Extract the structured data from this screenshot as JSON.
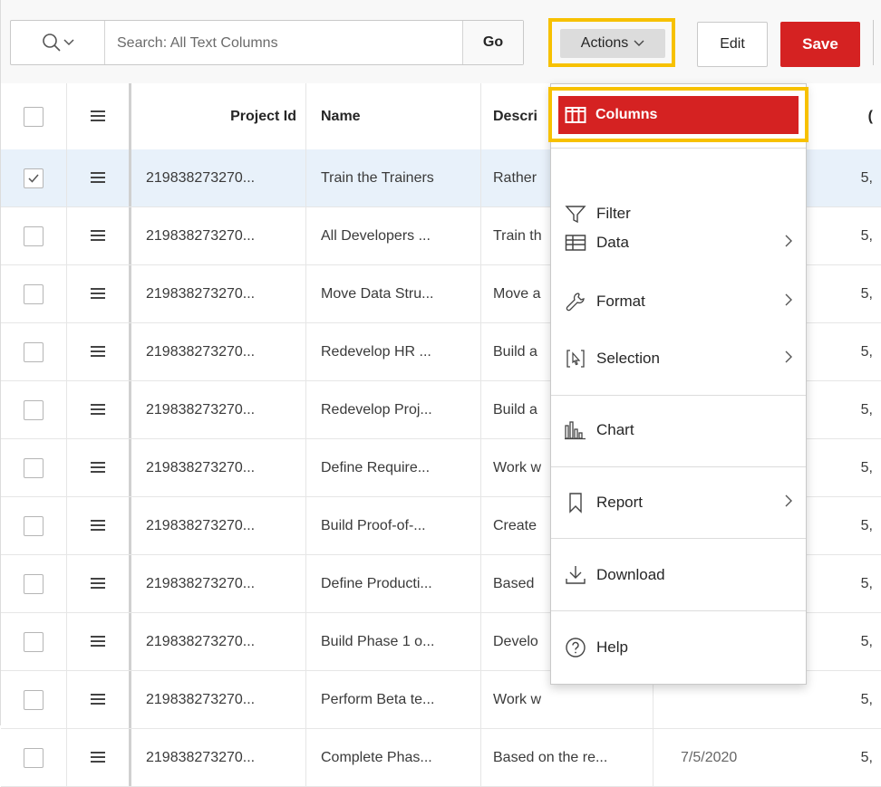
{
  "toolbar": {
    "search_placeholder": "Search: All Text Columns",
    "go_label": "Go",
    "actions_label": "Actions",
    "edit_label": "Edit",
    "save_label": "Save"
  },
  "grid": {
    "headers": {
      "project_id": "Project Id",
      "name": "Name",
      "description": "Descri",
      "date": "("
    },
    "rows": [
      {
        "project_id": "219838273270...",
        "name": "Train the Trainers",
        "description": "Rather",
        "date": "5,",
        "selected": true
      },
      {
        "project_id": "219838273270...",
        "name": "All Developers ...",
        "description": "Train th",
        "date": "5,"
      },
      {
        "project_id": "219838273270...",
        "name": "Move Data Stru...",
        "description": "Move a",
        "date": "5,"
      },
      {
        "project_id": "219838273270...",
        "name": "Redevelop HR ...",
        "description": "Build a",
        "date": "5,"
      },
      {
        "project_id": "219838273270...",
        "name": "Redevelop Proj...",
        "description": "Build a",
        "date": "5,"
      },
      {
        "project_id": "219838273270...",
        "name": "Define Require...",
        "description": "Work w",
        "date": "5,"
      },
      {
        "project_id": "219838273270...",
        "name": "Build Proof-of-...",
        "description": "Create",
        "date": "5,"
      },
      {
        "project_id": "219838273270...",
        "name": "Define Producti...",
        "description": "Based",
        "date": "5,"
      },
      {
        "project_id": "219838273270...",
        "name": "Build Phase 1 o...",
        "description": "Develo",
        "date": "5,"
      },
      {
        "project_id": "219838273270...",
        "name": "Perform Beta te...",
        "description": "Work w",
        "date": "5,"
      },
      {
        "project_id": "219838273270...",
        "name": "Complete Phas...",
        "description": "Based on the re...",
        "date_mid": "7/5/2020",
        "date": "5,"
      }
    ]
  },
  "actions_menu": {
    "items": [
      {
        "label": "Columns",
        "icon": "columns-icon",
        "active": true
      },
      {
        "label": "Filter",
        "icon": "filter-icon"
      },
      {
        "label": "Data",
        "icon": "table-icon",
        "submenu": true
      },
      {
        "label": "Format",
        "icon": "wrench-icon",
        "submenu": true
      },
      {
        "label": "Selection",
        "icon": "selection-icon",
        "submenu": true
      },
      {
        "label": "Chart",
        "icon": "chart-icon"
      },
      {
        "label": "Report",
        "icon": "bookmark-icon",
        "submenu": true
      },
      {
        "label": "Download",
        "icon": "download-icon"
      },
      {
        "label": "Help",
        "icon": "help-icon"
      }
    ]
  },
  "colors": {
    "accent_red": "#d52222",
    "highlight_yellow": "#f7c100",
    "selected_row": "#e8f1fa"
  }
}
